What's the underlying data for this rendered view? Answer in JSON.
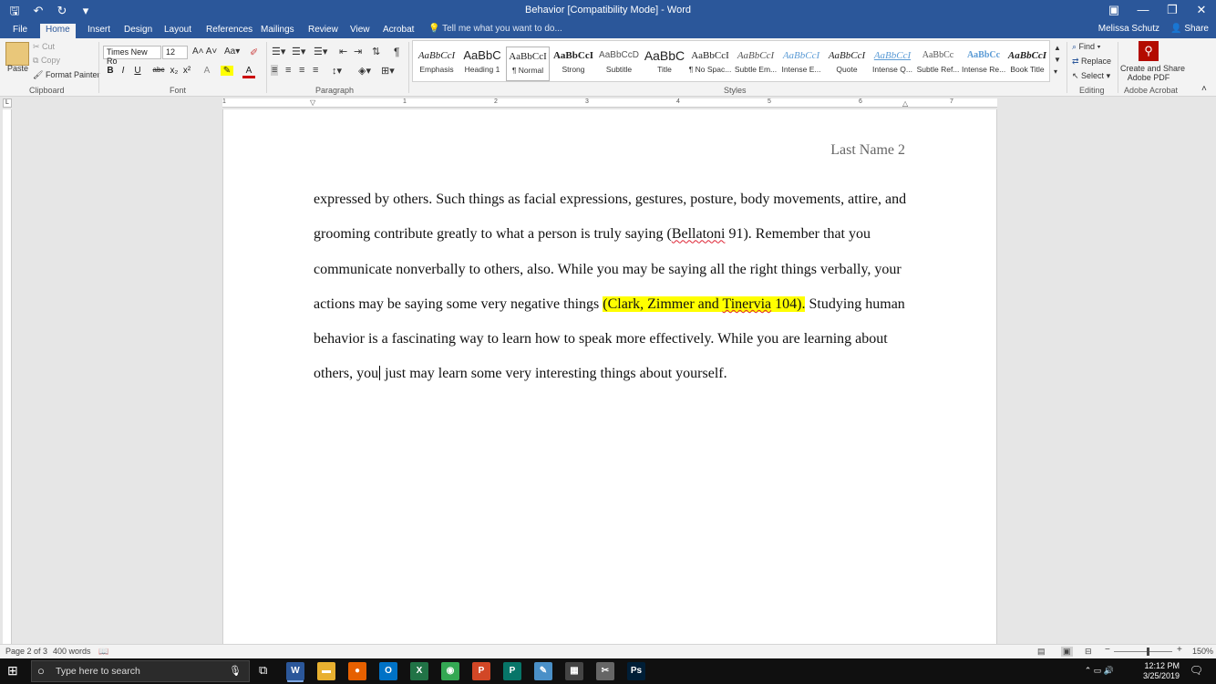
{
  "titlebar": {
    "title": "Behavior [Compatibility Mode] - Word",
    "save_icon": "save-icon",
    "undo": "↶",
    "redo": "↻",
    "minimize": "—",
    "restore": "❐",
    "close": "✕"
  },
  "tabs": {
    "items": [
      "File",
      "Home",
      "Insert",
      "Design",
      "Layout",
      "References",
      "Mailings",
      "Review",
      "View",
      "Acrobat"
    ],
    "active": "Home",
    "tell_me": "Tell me what you want to do...",
    "user": "Melissa Schutz",
    "share": "Share"
  },
  "ribbon": {
    "clipboard": {
      "label": "Clipboard",
      "paste": "Paste",
      "cut": "Cut",
      "copy": "Copy",
      "format_painter": "Format Painter"
    },
    "font": {
      "label": "Font",
      "family": "Times New Ro",
      "size": "12",
      "bold": "B",
      "italic": "I",
      "underline": "U",
      "strike": "abc",
      "sub": "x₂",
      "sup": "x²"
    },
    "paragraph": {
      "label": "Paragraph",
      "pilcrow": "¶"
    },
    "styles": {
      "label": "Styles",
      "items": [
        {
          "sample": "AaBbCcI",
          "name": "Emphasis"
        },
        {
          "sample": "AaBbC",
          "name": "Heading 1"
        },
        {
          "sample": "AaBbCcI",
          "name": "¶ Normal"
        },
        {
          "sample": "AaBbCcI",
          "name": "Strong"
        },
        {
          "sample": "AaBbCcD",
          "name": "Subtitle"
        },
        {
          "sample": "AaBbC",
          "name": "Title"
        },
        {
          "sample": "AaBbCcI",
          "name": "¶ No Spac..."
        },
        {
          "sample": "AaBbCcI",
          "name": "Subtle Em..."
        },
        {
          "sample": "AaBbCcI",
          "name": "Intense E..."
        },
        {
          "sample": "AaBbCcI",
          "name": "Quote"
        },
        {
          "sample": "AaBbCcI",
          "name": "Intense Q..."
        },
        {
          "sample": "AaBbCc",
          "name": "Subtle Ref..."
        },
        {
          "sample": "AaBbCc",
          "name": "Intense Re..."
        },
        {
          "sample": "AaBbCcI",
          "name": "Book Title"
        }
      ]
    },
    "editing": {
      "label": "Editing",
      "find": "Find",
      "replace": "Replace",
      "select": "Select"
    },
    "acrobat": {
      "label": "Adobe Acrobat",
      "create_line1": "Create and Share",
      "create_line2": "Adobe PDF"
    }
  },
  "ruler": {
    "numbers": [
      "1",
      "1",
      "2",
      "3",
      "4",
      "5",
      "6",
      "7"
    ]
  },
  "document": {
    "header": "Last Name 2",
    "p1": "expressed by others. Such things as facial expressions, gestures, posture, body movements, attire, and grooming contribute greatly to what a person is truly saying (",
    "cite1_name": "Bellatoni",
    "cite1_rest": " 91).  Remember that you communicate nonverbally to others, also.  While you may be saying all the right things verbally, your actions may be saying some very negative things ",
    "cite2_a": "(Clark, Zimmer and ",
    "cite2_name": "Tinervia",
    "cite2_b": " 104).",
    "p2_a": "  Studying human behavior is a fascinating way to learn how to speak more effectively. While you are learning about others, you",
    "p2_b": " just may learn some very interesting things about yourself."
  },
  "statusbar": {
    "page": "Page 2 of 3",
    "words": "400 words",
    "zoom": "150%",
    "zoom_minus": "−",
    "zoom_plus": "+"
  },
  "taskbar": {
    "search_placeholder": "Type here to search",
    "apps": [
      {
        "icon": "word-icon",
        "glyph": "W",
        "color": "#2b579a"
      },
      {
        "icon": "file-explorer-icon",
        "glyph": "▬",
        "color": "#e8b030"
      },
      {
        "icon": "firefox-icon",
        "glyph": "●",
        "color": "#e66000"
      },
      {
        "icon": "outlook-icon",
        "glyph": "O",
        "color": "#0072c6"
      },
      {
        "icon": "excel-icon",
        "glyph": "X",
        "color": "#217346"
      },
      {
        "icon": "chrome-icon",
        "glyph": "◉",
        "color": "#34a853"
      },
      {
        "icon": "powerpoint-icon",
        "glyph": "P",
        "color": "#d24726"
      },
      {
        "icon": "publisher-icon",
        "glyph": "P",
        "color": "#077568"
      },
      {
        "icon": "paint-icon",
        "glyph": "✎",
        "color": "#4a90c8"
      },
      {
        "icon": "calculator-icon",
        "glyph": "▦",
        "color": "#444"
      },
      {
        "icon": "snip-icon",
        "glyph": "✂",
        "color": "#666"
      },
      {
        "icon": "photoshop-icon",
        "glyph": "Ps",
        "color": "#001e36"
      }
    ],
    "time": "12:12 PM",
    "date": "3/25/2019"
  }
}
